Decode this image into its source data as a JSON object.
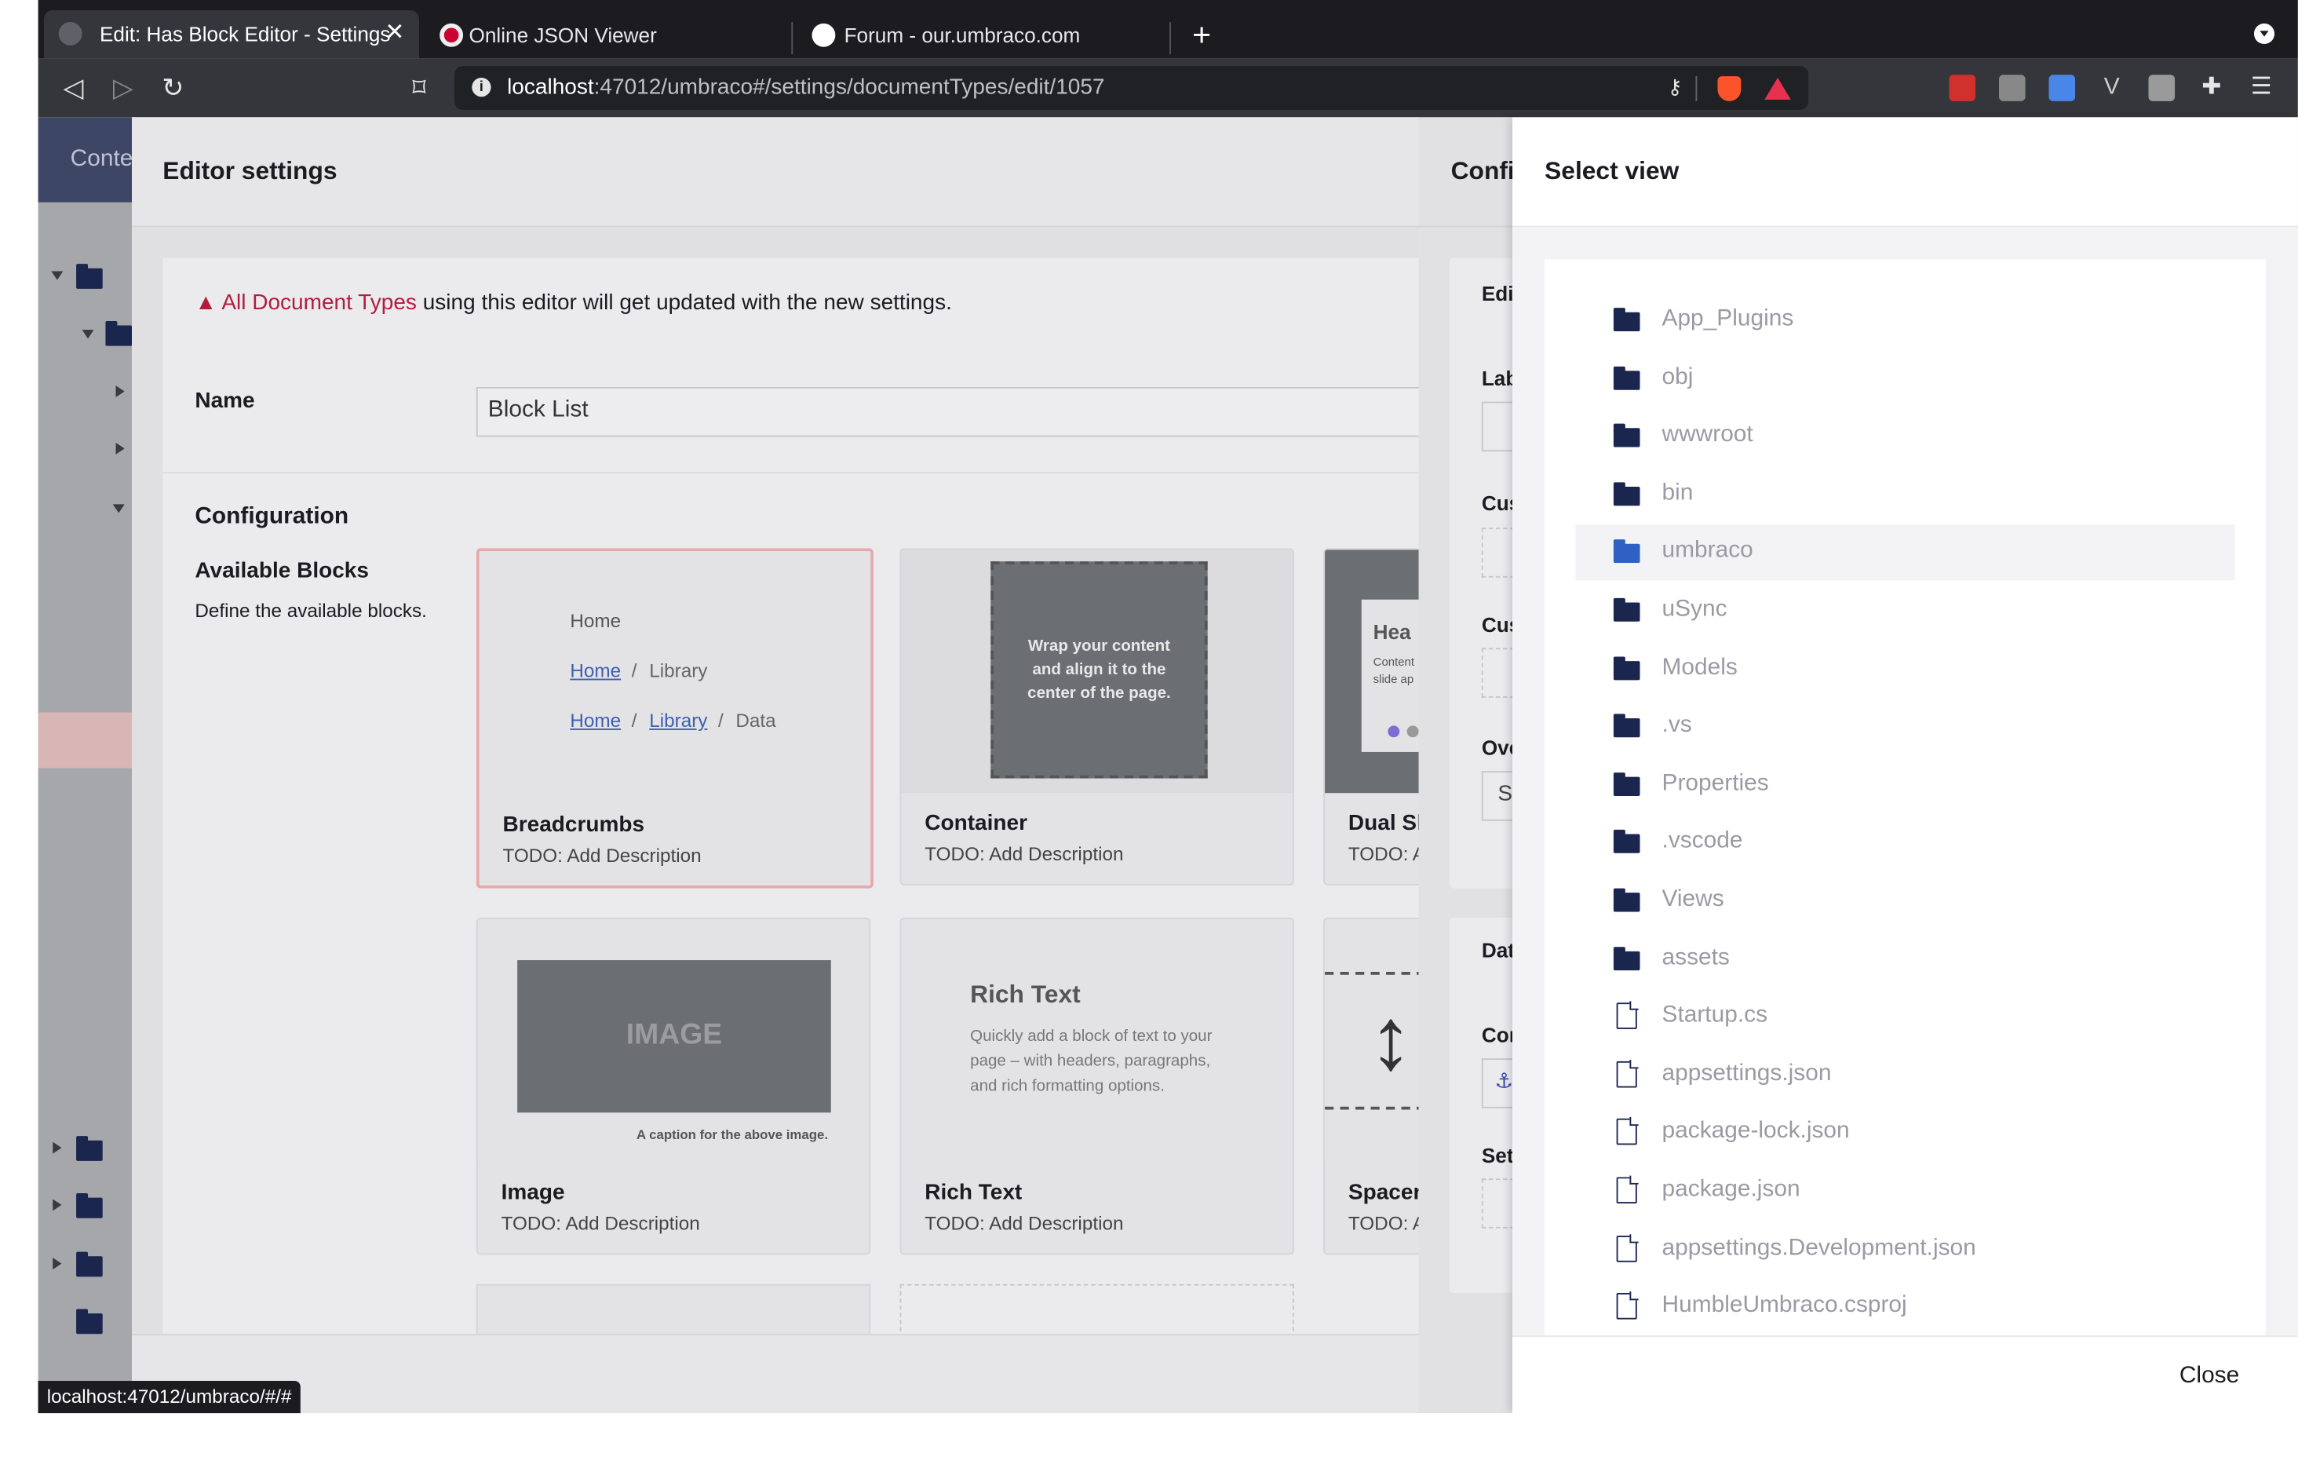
{
  "browser": {
    "tabs": [
      {
        "title": "Edit: Has Block Editor - Settings",
        "active": true
      },
      {
        "title": "Online JSON Viewer",
        "active": false
      },
      {
        "title": "Forum - our.umbraco.com",
        "active": false
      }
    ],
    "url_host": "localhost",
    "url_rest": ":47012/umbraco#/settings/documentTypes/edit/1057",
    "status_url": "localhost:47012/umbraco/#/#"
  },
  "sidebar": {
    "section_label": "Conte"
  },
  "editor": {
    "title": "Editor settings",
    "warning_highlight": "All Document Types",
    "warning_rest": " using this editor will get updated with the new settings.",
    "name_label": "Name",
    "name_value": "Block List",
    "configuration_label": "Configuration",
    "available_blocks_label": "Available Blocks",
    "available_blocks_desc": "Define the available blocks.",
    "blocks": [
      {
        "title": "Breadcrumbs",
        "desc": "TODO: Add Description",
        "selected": true,
        "preview": {
          "home": "Home",
          "library": "Library",
          "data": "Data",
          "sep": "/"
        }
      },
      {
        "title": "Container",
        "desc": "TODO: Add Description",
        "preview": {
          "line1": "Wrap your content",
          "line2": "and align it to the",
          "line3": "center of the page."
        }
      },
      {
        "title": "Dual Sl",
        "desc": "TODO: A",
        "preview": {
          "head": "Hea",
          "text1": "Content",
          "text2": "slide ap"
        }
      },
      {
        "title": "Image",
        "desc": "TODO: Add Description",
        "preview": {
          "image_text": "IMAGE",
          "caption": "A caption for the above image."
        }
      },
      {
        "title": "Rich Text",
        "desc": "TODO: Add Description",
        "preview": {
          "heading": "Rich Text",
          "line1": "Quickly add a block of text to your",
          "line2": "page – with headers, paragraphs,",
          "line3": "and rich formatting options."
        }
      },
      {
        "title": "Spacer",
        "desc": "TODO: A"
      }
    ]
  },
  "config_panel": {
    "title": "Confi",
    "labels": [
      "Edi",
      "Lab",
      "Cus",
      "Cus",
      "Ove",
      "Dat",
      "Cor",
      "Set"
    ],
    "select_value": "S"
  },
  "select_view": {
    "title": "Select view",
    "items": [
      {
        "name": "App_Plugins",
        "type": "folder"
      },
      {
        "name": "obj",
        "type": "folder"
      },
      {
        "name": "wwwroot",
        "type": "folder"
      },
      {
        "name": "bin",
        "type": "folder"
      },
      {
        "name": "umbraco",
        "type": "folder",
        "highlighted": true
      },
      {
        "name": "uSync",
        "type": "folder"
      },
      {
        "name": "Models",
        "type": "folder"
      },
      {
        "name": ".vs",
        "type": "folder"
      },
      {
        "name": "Properties",
        "type": "folder"
      },
      {
        "name": ".vscode",
        "type": "folder"
      },
      {
        "name": "Views",
        "type": "folder"
      },
      {
        "name": "assets",
        "type": "folder"
      },
      {
        "name": "Startup.cs",
        "type": "file"
      },
      {
        "name": "appsettings.json",
        "type": "file"
      },
      {
        "name": "package-lock.json",
        "type": "file"
      },
      {
        "name": "package.json",
        "type": "file"
      },
      {
        "name": "appsettings.Development.json",
        "type": "file"
      },
      {
        "name": "HumbleUmbraco.csproj",
        "type": "file"
      }
    ],
    "close_label": "Close"
  },
  "colors": {
    "accent": "#1b264f",
    "warning": "#b21d3e",
    "highlight_folder": "#2f61c4"
  },
  "icons": [
    "back-icon",
    "forward-icon",
    "reload-icon",
    "bookmark-icon",
    "info-icon",
    "key-icon",
    "brave-icon",
    "rewards-icon",
    "extensions-icon",
    "menu-icon",
    "folder-icon",
    "file-icon",
    "warning-icon"
  ]
}
